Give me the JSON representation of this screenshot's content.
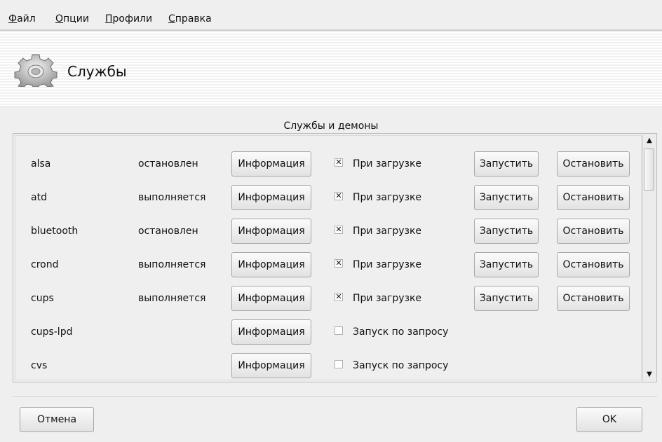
{
  "menubar": {
    "items": [
      {
        "first": "Ф",
        "rest": "айл"
      },
      {
        "first": "О",
        "rest": "пции"
      },
      {
        "first": "П",
        "rest": "рофили"
      },
      {
        "first": "С",
        "rest": "правка"
      }
    ]
  },
  "header": {
    "title": "Службы",
    "icon": "gear-icon"
  },
  "section": {
    "title": "Службы и демоны"
  },
  "services": [
    {
      "name": "alsa",
      "status": "остановлен",
      "info": "Информация",
      "checked": true,
      "boot_label": "При загрузке",
      "start": "Запустить",
      "stop": "Остановить"
    },
    {
      "name": "atd",
      "status": "выполняется",
      "info": "Информация",
      "checked": true,
      "boot_label": "При загрузке",
      "start": "Запустить",
      "stop": "Остановить"
    },
    {
      "name": "bluetooth",
      "status": "остановлен",
      "info": "Информация",
      "checked": true,
      "boot_label": "При загрузке",
      "start": "Запустить",
      "stop": "Остановить"
    },
    {
      "name": "crond",
      "status": "выполняется",
      "info": "Информация",
      "checked": true,
      "boot_label": "При загрузке",
      "start": "Запустить",
      "stop": "Остановить"
    },
    {
      "name": "cups",
      "status": "выполняется",
      "info": "Информация",
      "checked": true,
      "boot_label": "При загрузке",
      "start": "Запустить",
      "stop": "Остановить"
    },
    {
      "name": "cups-lpd",
      "status": "",
      "info": "Информация",
      "checked": false,
      "boot_label": "Запуск по запросу",
      "start": "",
      "stop": ""
    },
    {
      "name": "cvs",
      "status": "",
      "info": "Информация",
      "checked": false,
      "boot_label": "Запуск по запросу",
      "start": "",
      "stop": ""
    }
  ],
  "check_mark": "✕",
  "scroll": {
    "up": "▲",
    "down": "▼"
  },
  "footer": {
    "cancel_label": "Отмена",
    "ok_label": "OK"
  }
}
